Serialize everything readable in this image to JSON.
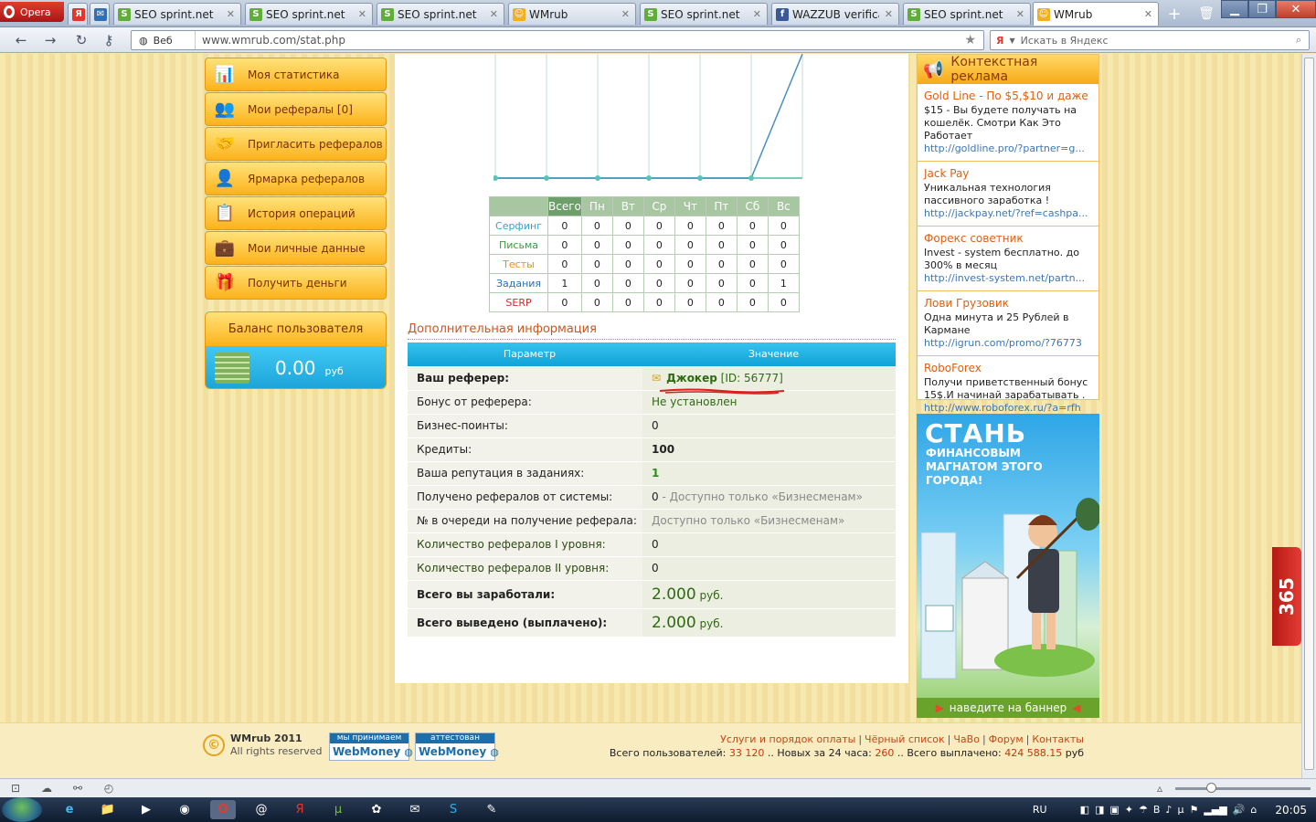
{
  "browser": {
    "opera_label": "Opera",
    "tabs": [
      {
        "title": "",
        "icon": "yandex-icon",
        "color": "#e0362b",
        "glyph": "Я",
        "active": false
      },
      {
        "title": "",
        "icon": "mail-icon",
        "color": "#2f6fb5",
        "glyph": "✉",
        "active": false
      },
      {
        "title": "SEO sprint.net",
        "icon": "seosprint-icon",
        "color": "#5fae3a",
        "glyph": "S",
        "active": false
      },
      {
        "title": "SEO sprint.net",
        "icon": "seosprint-icon",
        "color": "#5fae3a",
        "glyph": "S",
        "active": false
      },
      {
        "title": "SEO sprint.net",
        "icon": "seosprint-icon",
        "color": "#5fae3a",
        "glyph": "S",
        "active": false
      },
      {
        "title": "WMrub",
        "icon": "wmrub-icon",
        "color": "#f0b020",
        "glyph": "☺",
        "active": false
      },
      {
        "title": "SEO sprint.net",
        "icon": "seosprint-icon",
        "color": "#5fae3a",
        "glyph": "S",
        "active": false
      },
      {
        "title": "WAZZUB verificati...",
        "icon": "facebook-icon",
        "color": "#3b5998",
        "glyph": "f",
        "active": false
      },
      {
        "title": "SEO sprint.net",
        "icon": "seosprint-icon",
        "color": "#5fae3a",
        "glyph": "S",
        "active": false
      },
      {
        "title": "WMrub",
        "icon": "wmrub-icon",
        "color": "#f0b020",
        "glyph": "☺",
        "active": true
      }
    ],
    "web_label": "Веб",
    "url": "www.wmrub.com/stat.php",
    "search_placeholder": "Искать в Яндекс"
  },
  "menu": {
    "items": [
      {
        "label": "Моя статистика",
        "icon": "bar-chart-icon",
        "glyph": "📊"
      },
      {
        "label": "Мои рефералы [0]",
        "icon": "users-icon",
        "glyph": "👥"
      },
      {
        "label": "Пригласить рефералов",
        "icon": "handshake-icon",
        "glyph": "🤝"
      },
      {
        "label": "Ярмарка рефералов",
        "icon": "user-check-icon",
        "glyph": "👤"
      },
      {
        "label": "История операций",
        "icon": "history-icon",
        "glyph": "📋"
      },
      {
        "label": "Мои личные данные",
        "icon": "briefcase-icon",
        "glyph": "💼"
      },
      {
        "label": "Получить деньги",
        "icon": "gift-icon",
        "glyph": "🎁"
      }
    ]
  },
  "balance": {
    "title": "Баланс пользователя",
    "amount": "0.00",
    "currency": "руб"
  },
  "chart_data": {
    "type": "line",
    "x": [
      "1",
      "2",
      "3",
      "4",
      "5",
      "6",
      "7"
    ],
    "values": [
      0,
      0,
      0,
      0,
      0,
      0,
      1
    ],
    "ylim": [
      0,
      1
    ],
    "grid": true,
    "color": "#4a8fc0"
  },
  "stats": {
    "columns": [
      "Всего",
      "Пн",
      "Вт",
      "Ср",
      "Чт",
      "Пт",
      "Сб",
      "Вс"
    ],
    "rows": [
      {
        "label": "Серфинг",
        "color": "#3aa0d0",
        "values": [
          "0",
          "0",
          "0",
          "0",
          "0",
          "0",
          "0",
          "0"
        ]
      },
      {
        "label": "Письма",
        "color": "#3aa03a",
        "values": [
          "0",
          "0",
          "0",
          "0",
          "0",
          "0",
          "0",
          "0"
        ]
      },
      {
        "label": "Тесты",
        "color": "#e09020",
        "values": [
          "0",
          "0",
          "0",
          "0",
          "0",
          "0",
          "0",
          "0"
        ]
      },
      {
        "label": "Задания",
        "color": "#2a6fb0",
        "values": [
          "1",
          "0",
          "0",
          "0",
          "0",
          "0",
          "0",
          "1"
        ]
      },
      {
        "label": "SERP",
        "color": "#d02a2a",
        "values": [
          "0",
          "0",
          "0",
          "0",
          "0",
          "0",
          "0",
          "0"
        ]
      }
    ]
  },
  "info": {
    "title": "Дополнительная информация",
    "header": {
      "param": "Параметр",
      "value": "Значение"
    },
    "referrer": {
      "label": "Ваш реферер:",
      "name": "Джокер",
      "id": "[ID: 56777]"
    },
    "rows": [
      {
        "label": "Бонус от реферера:",
        "value": "Не установлен",
        "note": ""
      },
      {
        "label": "Бизнес-поинты:",
        "value": "0",
        "note": ""
      },
      {
        "label": "Кредиты:",
        "value": "100",
        "note": ""
      },
      {
        "label": "Ваша репутация в заданиях:",
        "value": "1",
        "note": ""
      },
      {
        "label": "Получено рефералов от системы:",
        "value": "0",
        "note": " - Доступно только «Бизнесменам»"
      },
      {
        "label": "№ в очереди на получение реферала:",
        "value": "",
        "note": "Доступно только «Бизнесменам»"
      },
      {
        "label": "Количество рефералов I уровня:",
        "value": "0",
        "note": ""
      },
      {
        "label": "Количество рефералов II уровня:",
        "value": "0",
        "note": ""
      }
    ],
    "totals": [
      {
        "label": "Всего вы заработали:",
        "amount": "2.000",
        "currency": "руб."
      },
      {
        "label": "Всего выведено (выплачено):",
        "amount": "2.000",
        "currency": "руб."
      }
    ]
  },
  "ads": {
    "title": "Контекстная реклама",
    "items": [
      {
        "title": "Gold Line - По $5,$10 и даже",
        "text": "$15 - Вы будете получать на кошелёк. Смотри Как Это Работает",
        "url": "http://goldline.pro/?partner=g..."
      },
      {
        "title": "Jack Pay",
        "text": "Уникальная технология пассивного заработка !",
        "url": "http://jackpay.net/?ref=cashpa..."
      },
      {
        "title": "Форекс советник",
        "text": "Invest - system бесплатно. до 300% в месяц",
        "url": "http://invest-system.net/partn..."
      },
      {
        "title": "Лови Грузовик",
        "text": "Одна минута и 25 Рублей в Кармане",
        "url": "http://igrun.com/promo/?76773"
      },
      {
        "title": "RoboForex",
        "text": "Получи приветственный бонус 15$.И начинай зарабатывать .",
        "url": "http://www.roboforex.ru/?a=rfh"
      }
    ]
  },
  "banner": {
    "headline": "СТАНЬ",
    "subline": "ФИНАНСОВЫМ МАГНАТОМ ЭТОГО ГОРОДА!",
    "footer": "наведите на баннер"
  },
  "side_widget": {
    "label": "365"
  },
  "footer": {
    "brand": "WMrub 2011",
    "rights": "All rights reserved",
    "badges": [
      {
        "top": "мы принимаем",
        "bottom": "WebMoney"
      },
      {
        "top": "аттестован",
        "bottom": "WebMoney"
      }
    ],
    "links": [
      "Услуги и порядок оплаты",
      "Чёрный список",
      "ЧаВо",
      "Форум",
      "Контакты"
    ],
    "stats": {
      "users_label": "Всего пользователей:",
      "users": "33 120",
      "new_label": "Новых за 24 часа:",
      "new": "260",
      "paid_label": "Всего выплачено:",
      "paid": "424 588.15",
      "paid_unit": "руб"
    }
  },
  "taskbar": {
    "lang": "RU",
    "time": "20:05"
  }
}
